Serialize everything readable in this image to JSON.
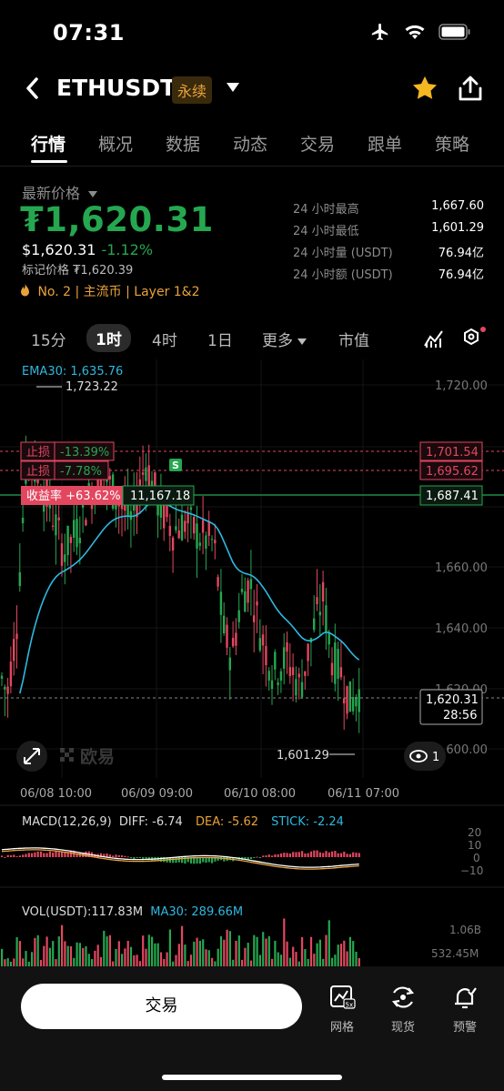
{
  "status": {
    "time": "07:31"
  },
  "header": {
    "pair": "ETHUSDT",
    "badge": "永续"
  },
  "tabs": [
    "行情",
    "概况",
    "数据",
    "动态",
    "交易",
    "跟单",
    "策略"
  ],
  "price": {
    "label": "最新价格",
    "main": "₮1,620.31",
    "usd": "$1,620.31",
    "change": "-1.12%",
    "mark": "标记价格 ₮1,620.39",
    "tags": "No. 2  |  主流币  |  Layer 1&2"
  },
  "stats": [
    {
      "k": "24 小时最高",
      "v": "1,667.60"
    },
    {
      "k": "24 小时最低",
      "v": "1,601.29"
    },
    {
      "k": "24 小时量 (USDT)",
      "v": "76.94亿"
    },
    {
      "k": "24 小时额 (USDT)",
      "v": "76.94亿"
    }
  ],
  "intervals": [
    "15分",
    "1时",
    "4时",
    "1日",
    "更多",
    "市值"
  ],
  "chart": {
    "ema_label": "EMA30: 1,635.76",
    "high_label": "1,723.22",
    "low_label": "1,601.29",
    "y_ticks": [
      "1,720.00",
      "1,660.00",
      "1,640.00",
      "1,620.00",
      "1,600.00"
    ],
    "stop1": {
      "label": "止损",
      "pct": "-13.39%",
      "price": "1,701.54"
    },
    "stop2": {
      "label": "止损",
      "pct": "-7.78%",
      "price": "1,695.62"
    },
    "profit": {
      "label": "收益率 +63.62%",
      "value": "11,167.18",
      "price": "1,687.41"
    },
    "current": {
      "price": "1,620.31",
      "countdown": "28:56"
    },
    "x_ticks": [
      "06/08 10:00",
      "06/09 09:00",
      "06/10 08:00",
      "06/11 07:00"
    ],
    "watermark": "欧易",
    "s_marker": "S",
    "eye_count": "1"
  },
  "macd": {
    "label": "MACD(12,26,9)",
    "diff": "DIFF: -6.74",
    "dea": "DEA: -5.62",
    "stick": "STICK: -2.24",
    "ticks": [
      "20",
      "10",
      "0",
      "−10"
    ]
  },
  "vol": {
    "label": "VOL(USDT):117.83M",
    "ma": "MA30: 289.66M",
    "ticks": [
      "1.06B",
      "532.45M"
    ]
  },
  "bottom": {
    "trade": "交易",
    "grid": "网格",
    "spot": "现货",
    "alert": "预警"
  },
  "colors": {
    "up": "#25a750",
    "down": "#e2475f",
    "accent": "#e9a23b"
  }
}
